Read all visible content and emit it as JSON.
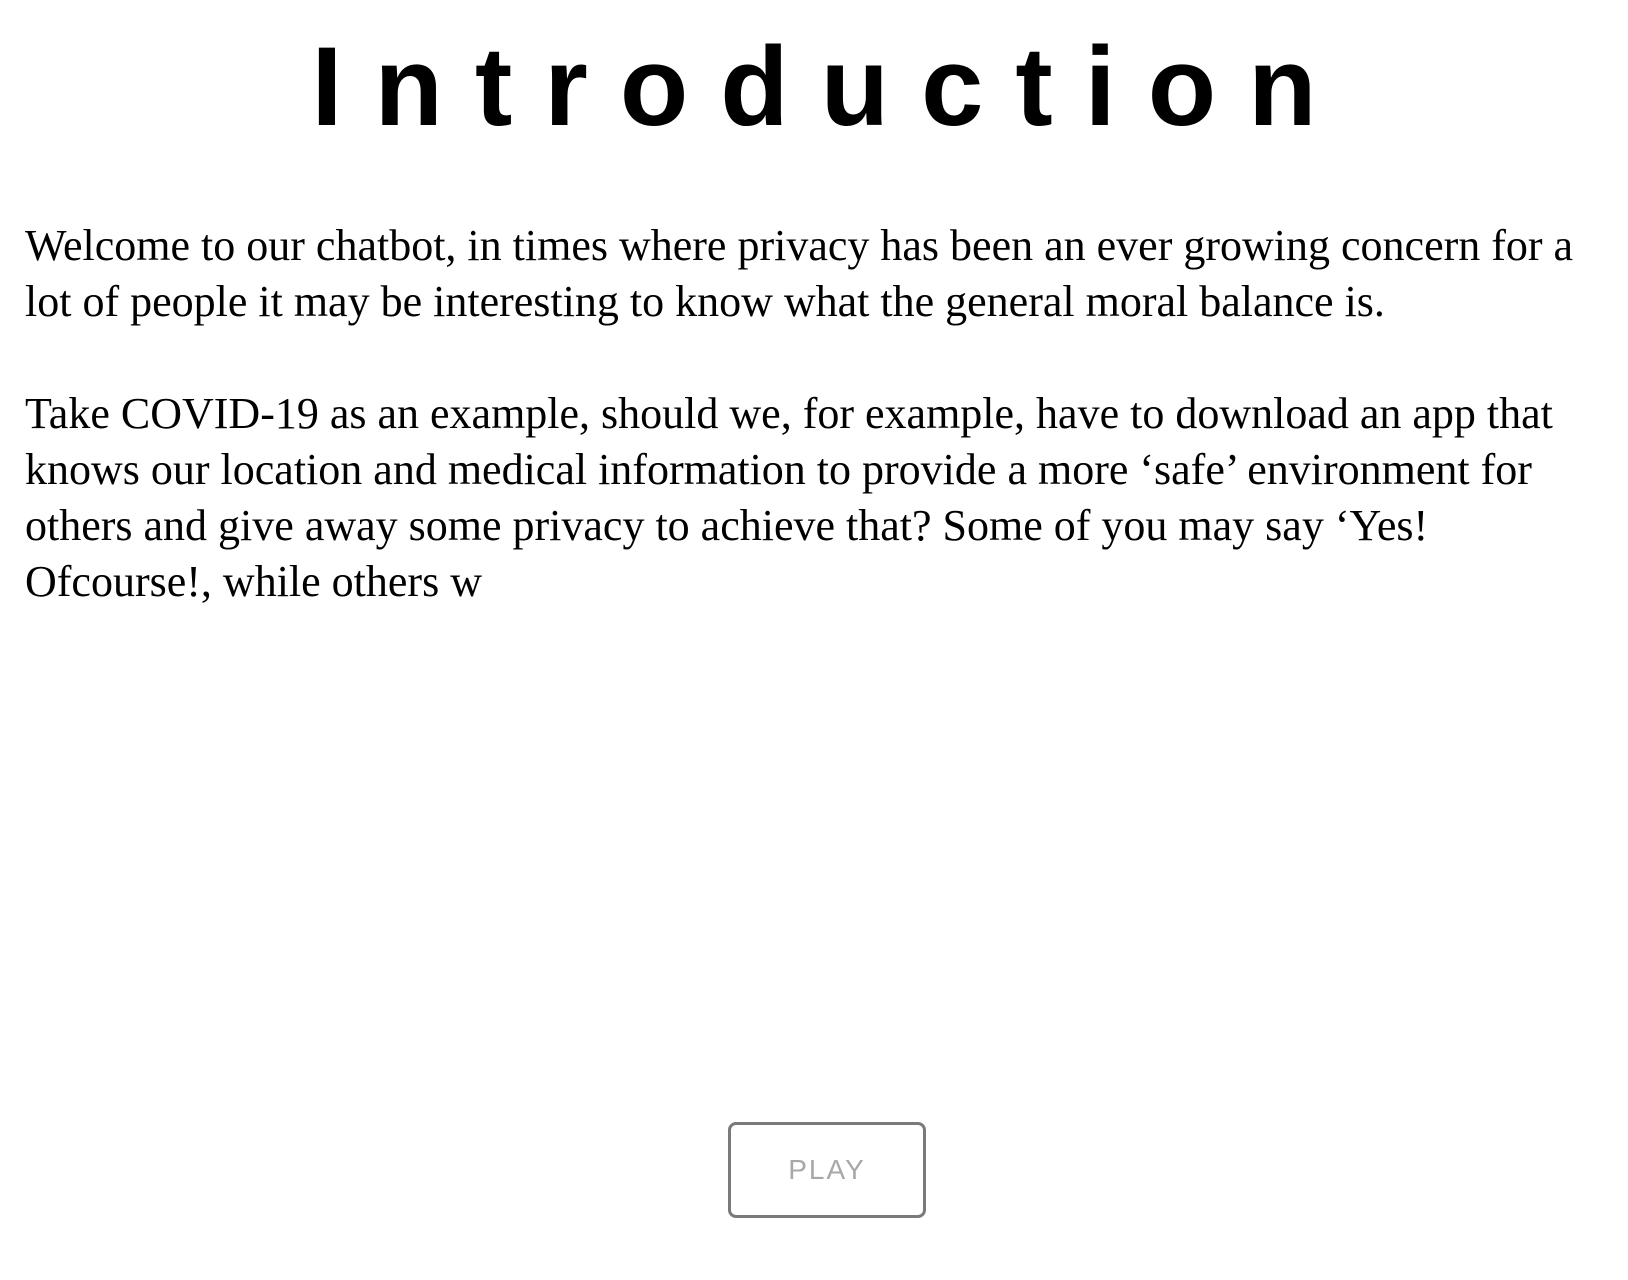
{
  "title": "Introduction",
  "paragraphs": [
    "Welcome to our chatbot, in times where privacy has been an ever growing concern for a lot of people it may be interesting to know what the general moral balance is.",
    "Take COVID-19 as an example, should we, for example, have to download an app that knows our location and medical information to provide a more ‘safe’ environment for others and give away some privacy to achieve that? Some of you may say ‘Yes! Ofcourse!, while others w"
  ],
  "play_button": {
    "label": "PLAY"
  }
}
